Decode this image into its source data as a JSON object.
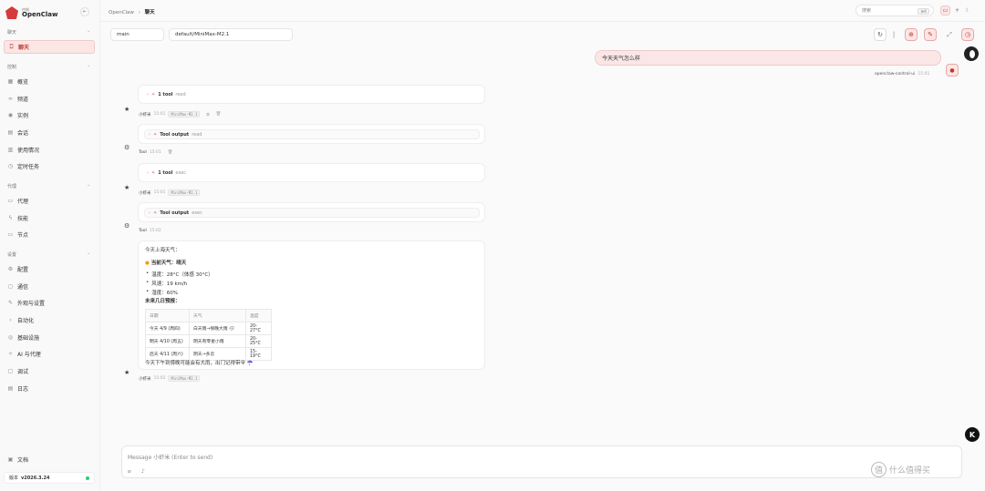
{
  "brand": {
    "sub": "控制",
    "name": "OpenClaw"
  },
  "sidebar": {
    "chat_section": "聊天",
    "chat_item": "聊天",
    "control_section": "控制",
    "control_items": [
      "概览",
      "频道",
      "实例",
      "会话",
      "使用情况",
      "定时任务"
    ],
    "agent_section": "代理",
    "agent_items": [
      "代理",
      "技能",
      "节点"
    ],
    "settings_section": "设置",
    "settings_items": [
      "配置",
      "通信",
      "外观与设置",
      "自动化",
      "基础设施",
      "AI 与代理",
      "调试",
      "日志"
    ],
    "docs": "文档",
    "version_label": "版本",
    "version_value": "v2026.3.24"
  },
  "topbar": {
    "breadcrumb_root": "OpenClaw",
    "breadcrumb_sep": "›",
    "breadcrumb_current": "聊天",
    "search_placeholder": "搜索",
    "search_shortcut": "⌘K"
  },
  "session": {
    "agent": "main",
    "model": "default/MiniMax-M2.1"
  },
  "user_message": {
    "text": "今天天气怎么样",
    "sender": "openclaw-control-ui",
    "time": "15:01"
  },
  "messages": [
    {
      "tool_label": "1 tool",
      "tool_name": "read",
      "author": "小虾米",
      "time": "15:01",
      "model": "MiniMax-M2.1"
    },
    {
      "tool_label": "Tool output",
      "tool_name": "read",
      "author": "Tool",
      "time": "15:01"
    },
    {
      "tool_label": "1 tool",
      "tool_name": "exec",
      "author": "小虾米",
      "time": "15:01",
      "model": "MiniMax-M2.1"
    },
    {
      "tool_label": "Tool output",
      "tool_name": "exec",
      "author": "Tool",
      "time": "15:02"
    }
  ],
  "answer": {
    "intro": "今天上海天气：",
    "current_heading": "当前天气：晴天",
    "bullets": [
      "温度：28°C（体感 30°C）",
      "风速：19 km/h",
      "湿度：60%"
    ],
    "forecast_heading": "未来几日预报：",
    "table_headers": [
      "日期",
      "天气",
      "温度"
    ],
    "table_rows": [
      [
        "今天 4/9 (周四)",
        "白天雨→傍晚大雨 🌧",
        "20-27°C"
      ],
      [
        "明天 4/10 (周五)",
        "阴天有零星小雨",
        "20-25°C"
      ],
      [
        "后天 4/11 (周六)",
        "阴天→多云",
        "15-19°C"
      ]
    ],
    "note": "今天下午到傍晚可能会有大雨，出门记得带伞 ☂️",
    "author": "小虾米",
    "time": "15:02",
    "model": "MiniMax-M2.1"
  },
  "composer": {
    "placeholder": "Message 小虾米 (Enter to send)"
  },
  "watermark": {
    "glyph": "值",
    "text": "什么值得买"
  },
  "accent": "#c0392b"
}
